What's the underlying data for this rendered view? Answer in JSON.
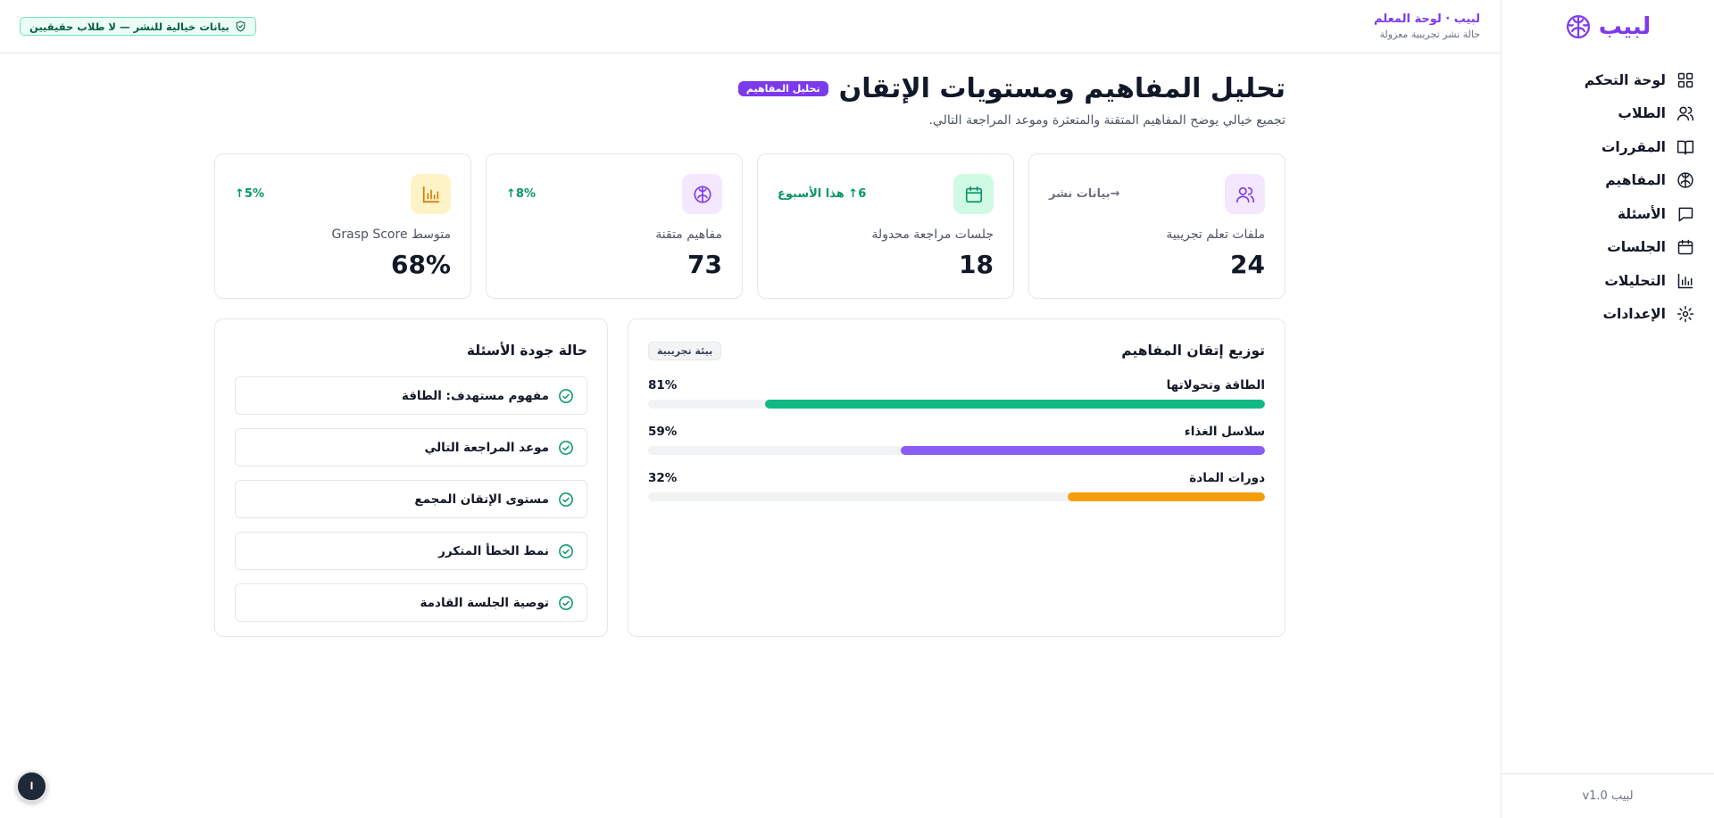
{
  "app": {
    "brand": "لبيب",
    "version": "لبيب v1.0"
  },
  "colors": {
    "accent": "#7c3aed",
    "green": "#10b981",
    "purple": "#8b5cf6",
    "orange": "#f59e0b"
  },
  "sidebar": {
    "items": [
      {
        "label": "لوحة التحكم",
        "icon": "dashboard-grid-icon"
      },
      {
        "label": "الطلاب",
        "icon": "user-icon"
      },
      {
        "label": "المقررات",
        "icon": "book-icon"
      },
      {
        "label": "المفاهيم",
        "icon": "brain-icon"
      },
      {
        "label": "الأسئلة",
        "icon": "message-icon"
      },
      {
        "label": "الجلسات",
        "icon": "calendar-icon"
      },
      {
        "label": "التحليلات",
        "icon": "bar-chart-icon"
      },
      {
        "label": "الإعدادات",
        "icon": "gear-icon"
      }
    ]
  },
  "header": {
    "title": "لبيب · لوحة المعلم",
    "subtitle": "حالة نشر تجريبية معزولة",
    "notice": "بيانات خيالية للنشر — لا طلاب حقيقيين"
  },
  "page": {
    "title": "تحليل المفاهيم ومستويات الإتقان",
    "tag": "تحليل المفاهيم",
    "subtitle": "تجميع خيالي يوضح المفاهيم المتقنة والمتعثرة وموعد المراجعة التالي."
  },
  "stats": [
    {
      "label": "ملفات تعلم تجريبية",
      "value": "24",
      "trend": "→بيانات نشر",
      "trend_color": "#6b7280",
      "icon": "users-icon",
      "icon_bg": "#f3e8ff",
      "icon_color": "#7c3aed"
    },
    {
      "label": "جلسات مراجعة محدولة",
      "value": "18",
      "trend": "6↑ هذا الأسبوع",
      "trend_color": "#059669",
      "icon": "calendar-icon",
      "icon_bg": "#d1fae5",
      "icon_color": "#059669"
    },
    {
      "label": "مفاهيم متقنة",
      "value": "73",
      "trend": "8%↑",
      "trend_color": "#059669",
      "icon": "brain-icon",
      "icon_bg": "#f3e8ff",
      "icon_color": "#7c3aed"
    },
    {
      "label": "متوسط Grasp Score",
      "value": "68%",
      "trend": "5%↑",
      "trend_color": "#059669",
      "icon": "bar-chart-icon",
      "icon_bg": "#fef3c7",
      "icon_color": "#d97706"
    }
  ],
  "distribution": {
    "title": "توزيع إتقان المفاهيم",
    "badge": "بيئة تجريبية",
    "rows": [
      {
        "label": "الطاقة وتحولاتها",
        "value": 81,
        "value_label": "81%",
        "color": "#10b981"
      },
      {
        "label": "سلاسل الغذاء",
        "value": 59,
        "value_label": "59%",
        "color": "#8b5cf6"
      },
      {
        "label": "دورات المادة",
        "value": 32,
        "value_label": "32%",
        "color": "#f59e0b"
      }
    ]
  },
  "quality": {
    "title": "حالة جودة الأسئلة",
    "items": [
      "مفهوم مستهدف: الطاقة",
      "موعد المراجعة التالي",
      "مستوى الإتقان المجمع",
      "نمط الخطأ المتكرر",
      "توصية الجلسة القادمة"
    ]
  },
  "help": {
    "label": "ا"
  }
}
